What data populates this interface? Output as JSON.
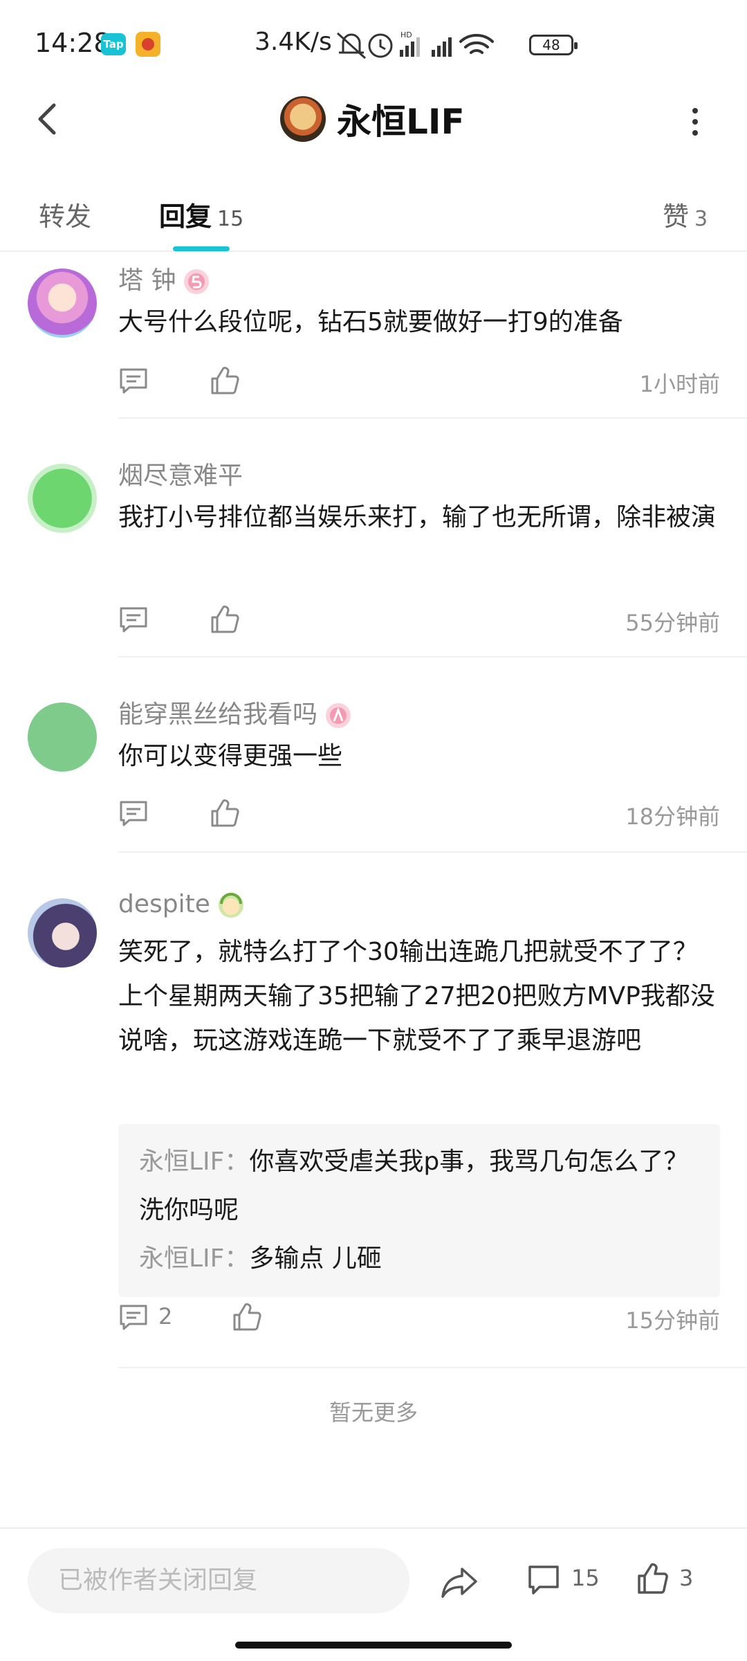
{
  "status_bar": {
    "time": "14:28",
    "app_badge": "Tap",
    "net_speed": "3.4K/s",
    "battery": "48"
  },
  "header": {
    "title": "永恒LIF"
  },
  "tabs": {
    "forward": "转发",
    "reply": "回复",
    "reply_count": "15",
    "like": "赞",
    "like_count": "3"
  },
  "comments": [
    {
      "name": "塔 钟",
      "text": "大号什么段位呢，钻石5就要做好一打9的准备",
      "time": "1小时前"
    },
    {
      "name": "烟尽意难平",
      "text": "我打小号排位都当娱乐来打，输了也无所谓，除非被演",
      "time": "55分钟前"
    },
    {
      "name": "能穿黑丝给我看吗",
      "text": "你可以变得更强一些",
      "time": "18分钟前"
    },
    {
      "name": "despite",
      "text": "笑死了，就特么打了个30输出连跪几把就受不了了？上个星期两天输了35把输了27把20把败方MVP我都没说啥，玩这游戏连跪一下就受不了了乘早退游吧",
      "time": "15分钟前",
      "comment_count": "2",
      "replies": [
        {
          "user": "永恒LIF",
          "sep": "：",
          "text": "你喜欢受虐关我p事，我骂几句怎么了？洗你吗呢"
        },
        {
          "user": "永恒LIF",
          "sep": "：",
          "text": "多输点 儿砸"
        }
      ]
    }
  ],
  "no_more": "暂无更多",
  "bottom_bar": {
    "placeholder": "已被作者关闭回复",
    "comment_count": "15",
    "like_count": "3"
  },
  "colors": {
    "accent": "#19c3d6",
    "icon_gray": "#8a8a8a"
  }
}
